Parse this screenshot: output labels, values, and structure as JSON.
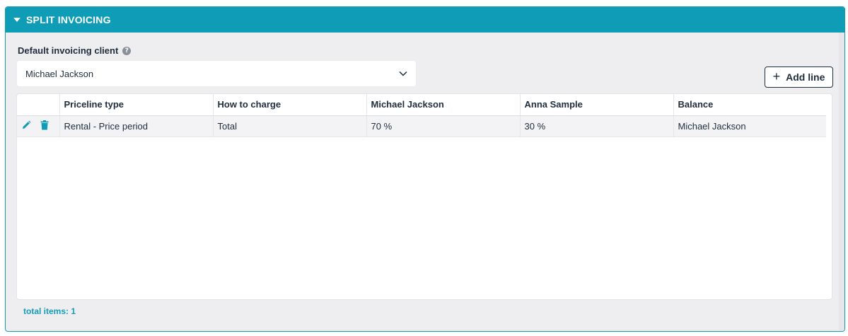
{
  "panel": {
    "title": "SPLIT INVOICING"
  },
  "default_client": {
    "label": "Default invoicing client",
    "help_symbol": "?",
    "selected_value": "Michael Jackson"
  },
  "add_line": {
    "plus": "+",
    "label": "Add line"
  },
  "table": {
    "columns": [
      "",
      "Priceline type",
      "How to charge",
      "Michael Jackson",
      "Anna Sample",
      "Balance"
    ],
    "rows": [
      {
        "priceline_type": "Rental - Price period",
        "how_to_charge": "Total",
        "michael_jackson": "70 %",
        "anna_sample": "30 %",
        "balance": "Michael Jackson"
      }
    ]
  },
  "footer": {
    "total_items": "total items: 1"
  },
  "colors": {
    "accent": "#0f9cb6",
    "text": "#1f2d3d",
    "panel_bg": "#eeeef0"
  },
  "icons": {
    "header_caret": "caret-down-icon",
    "help": "help-icon",
    "select": "chevron-down-icon",
    "edit": "pencil-icon",
    "delete": "trash-icon"
  }
}
